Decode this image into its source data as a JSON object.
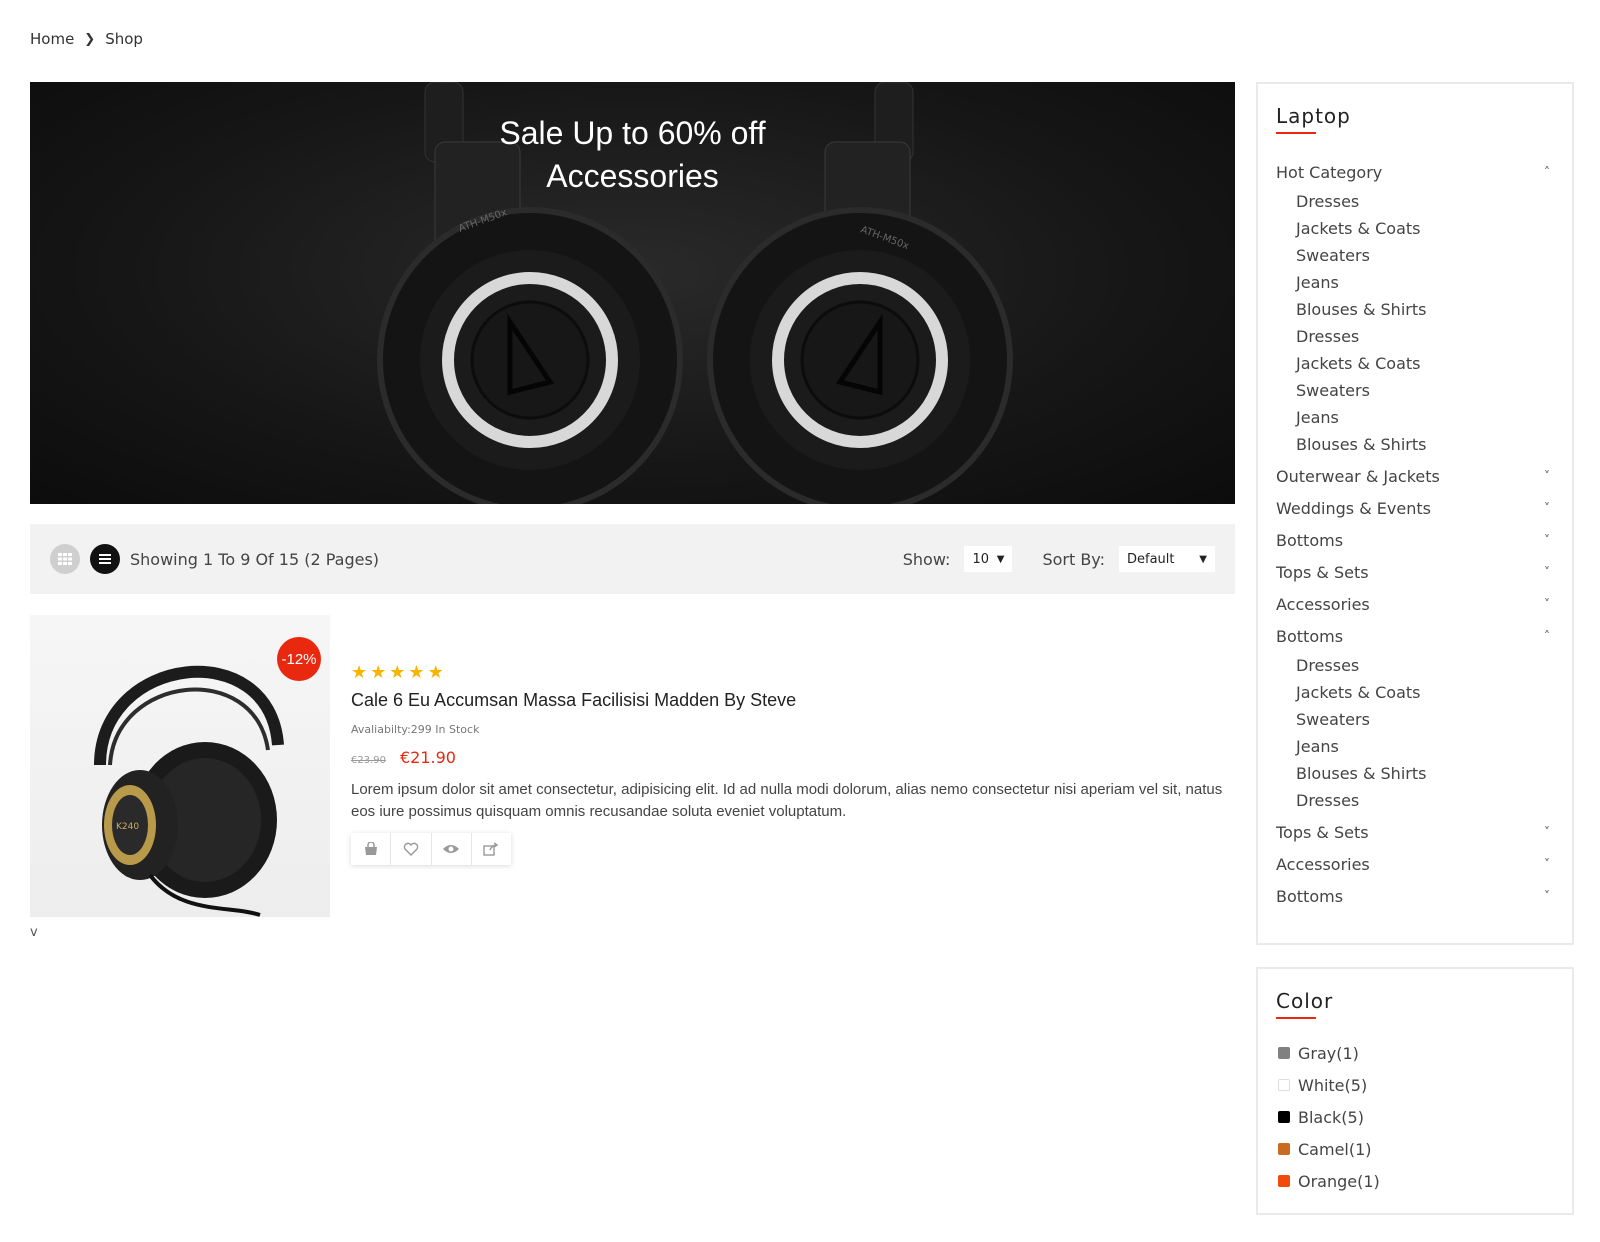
{
  "breadcrumb": {
    "home": "Home",
    "current": "Shop"
  },
  "banner": {
    "line1": "Sale Up to 60% off",
    "line2": "Accessories"
  },
  "toolbar": {
    "showing": "Showing 1 To 9 Of 15 (2 Pages)",
    "show_label": "Show:",
    "show_value": "10",
    "sort_label": "Sort By:",
    "sort_value": "Default"
  },
  "product": {
    "discount": "-12%",
    "rating": 5,
    "title": "Cale 6 Eu Accumsan Massa Facilisisi Madden By Steve",
    "availability": "Avaliabilty:299 In Stock",
    "old_price": "€23.90",
    "new_price": "€21.90",
    "description": "Lorem ipsum dolor sit amet consectetur, adipisicing elit. Id ad nulla modi dolorum, alias nemo consectetur nisi aperiam vel sit, natus eos iure possimus quisquam omnis recusandae soluta eveniet voluptatum.",
    "actions": [
      "cart-icon",
      "heart-icon",
      "eye-icon",
      "share-icon"
    ]
  },
  "stray_text": "v",
  "category_panel": {
    "title": "Laptop",
    "items": [
      {
        "label": "Hot Category",
        "expanded": true,
        "children": [
          "Dresses",
          "Jackets & Coats",
          "Sweaters",
          "Jeans",
          "Blouses & Shirts",
          "Dresses",
          "Jackets & Coats",
          "Sweaters",
          "Jeans",
          "Blouses & Shirts"
        ]
      },
      {
        "label": "Outerwear & Jackets",
        "expanded": false
      },
      {
        "label": "Weddings & Events",
        "expanded": false
      },
      {
        "label": "Bottoms",
        "expanded": false
      },
      {
        "label": "Tops & Sets",
        "expanded": false
      },
      {
        "label": "Accessories",
        "expanded": false
      },
      {
        "label": "Bottoms",
        "expanded": true,
        "children": [
          "Dresses",
          "Jackets & Coats",
          "Sweaters",
          "Jeans",
          "Blouses & Shirts",
          "Dresses"
        ]
      },
      {
        "label": "Tops & Sets",
        "expanded": false
      },
      {
        "label": "Accessories",
        "expanded": false
      },
      {
        "label": "Bottoms",
        "expanded": false
      }
    ]
  },
  "color_panel": {
    "title": "Color",
    "items": [
      {
        "label": "Gray(1)",
        "color": "#808080"
      },
      {
        "label": "White(5)",
        "color": "#ffffff"
      },
      {
        "label": "Black(5)",
        "color": "#000000"
      },
      {
        "label": "Camel(1)",
        "color": "#c96a1e"
      },
      {
        "label": "Orange(1)",
        "color": "#f24a0c"
      }
    ]
  },
  "colors": {
    "accent": "#e8280f",
    "star": "#f7b500",
    "toolbar_bg": "#f2f2f2"
  }
}
